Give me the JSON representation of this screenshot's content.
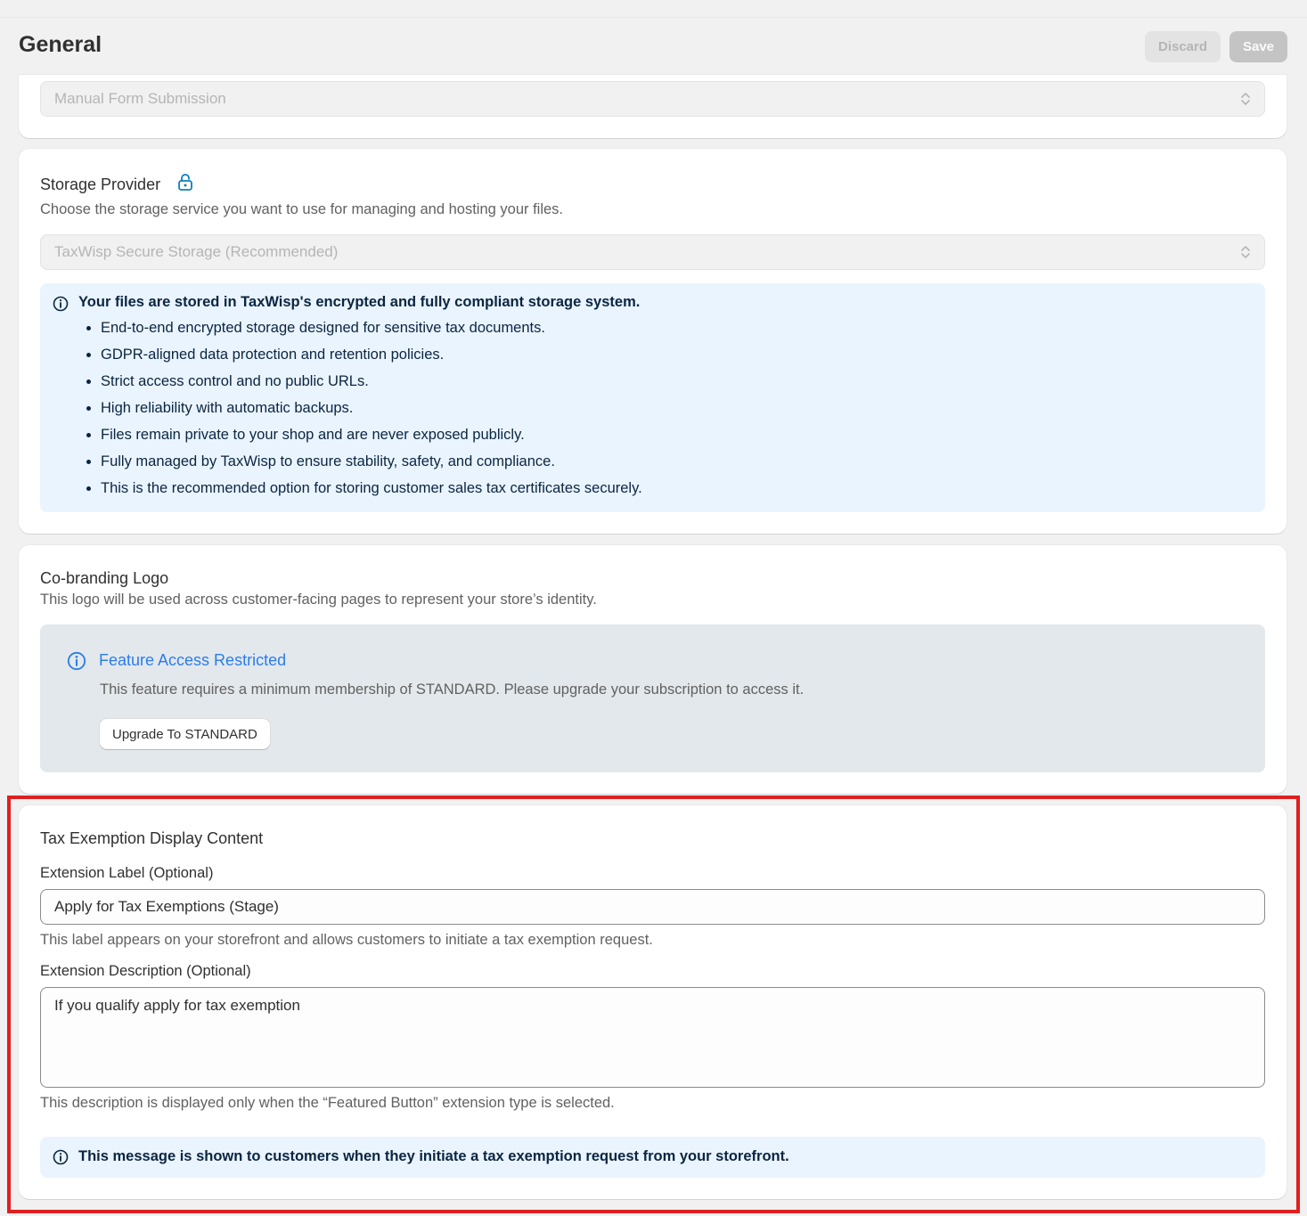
{
  "header": {
    "title": "General",
    "discard_label": "Discard",
    "save_label": "Save"
  },
  "submission_method": {
    "selected": "Manual Form Submission"
  },
  "storage_provider": {
    "title": "Storage Provider",
    "description": "Choose the storage service you want to use for managing and hosting your files.",
    "selected": "TaxWisp Secure Storage (Recommended)",
    "info_title": "Your files are stored in TaxWisp's encrypted and fully compliant storage system.",
    "info_points": [
      "End-to-end encrypted storage designed for sensitive tax documents.",
      "GDPR-aligned data protection and retention policies.",
      "Strict access control and no public URLs.",
      "High reliability with automatic backups.",
      "Files remain private to your shop and are never exposed publicly.",
      "Fully managed by TaxWisp to ensure stability, safety, and compliance.",
      "This is the recommended option for storing customer sales tax certificates securely."
    ],
    "icons": [
      "lock-icon",
      "info-icon"
    ],
    "accent_color": "#0b7fb5"
  },
  "cobranding": {
    "title": "Co-branding Logo",
    "description": "This logo will be used across customer-facing pages to represent your store’s identity.",
    "restricted_title": "Feature Access Restricted",
    "restricted_text": "This feature requires a minimum membership of STANDARD. Please upgrade your subscription to access it.",
    "upgrade_label": "Upgrade To STANDARD",
    "accent_color": "#2b7de9"
  },
  "tax_exemption": {
    "title": "Tax Exemption Display Content",
    "label_field_label": "Extension Label (Optional)",
    "label_field_value": "Apply for Tax Exemptions (Stage)",
    "label_help": "This label appears on your storefront and allows customers to initiate a tax exemption request.",
    "description_field_label": "Extension Description (Optional)",
    "description_field_value": "If you qualify apply for tax exemption",
    "description_help": "This description is displayed only when the “Featured Button” extension type is selected.",
    "notice": "This message is shown to customers when they initiate a tax exemption request from your storefront.",
    "highlight_color": "#e02020"
  }
}
